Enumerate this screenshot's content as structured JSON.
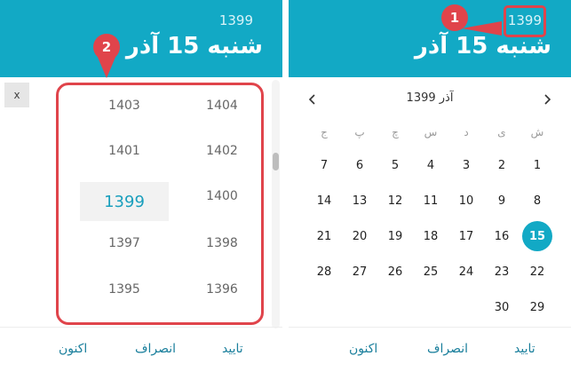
{
  "left": {
    "header": {
      "year": "1399",
      "date": "شنبه 15 آذر"
    },
    "close_label": "x",
    "years": [
      "1404",
      "1403",
      "1402",
      "1401",
      "1400",
      "1399",
      "1398",
      "1397",
      "1396",
      "1395"
    ],
    "selected_year": "1399",
    "footer": {
      "confirm": "تایید",
      "cancel": "انصراف",
      "now": "اکنون"
    }
  },
  "right": {
    "header": {
      "year": "1399",
      "date": "شنبه 15 آذر"
    },
    "month_title": "آذر 1399",
    "prev_icon": "chevron-right-icon",
    "next_icon": "chevron-left-icon",
    "weekdays": [
      "ش",
      "ی",
      "د",
      "س",
      "چ",
      "پ",
      "ج"
    ],
    "weeks": [
      [
        "1",
        "2",
        "3",
        "4",
        "5",
        "6",
        "7"
      ],
      [
        "8",
        "9",
        "10",
        "11",
        "12",
        "13",
        "14"
      ],
      [
        "15",
        "16",
        "17",
        "18",
        "19",
        "20",
        "21"
      ],
      [
        "22",
        "23",
        "24",
        "25",
        "26",
        "27",
        "28"
      ],
      [
        "29",
        "30",
        "",
        "",
        "",
        "",
        ""
      ]
    ],
    "selected_day": "15",
    "footer": {
      "confirm": "تایید",
      "cancel": "انصراف",
      "now": "اکنون"
    }
  },
  "annotations": {
    "marker_1": "1",
    "marker_2": "2"
  },
  "colors": {
    "accent": "#12a9c5",
    "highlight": "#e0444b"
  }
}
